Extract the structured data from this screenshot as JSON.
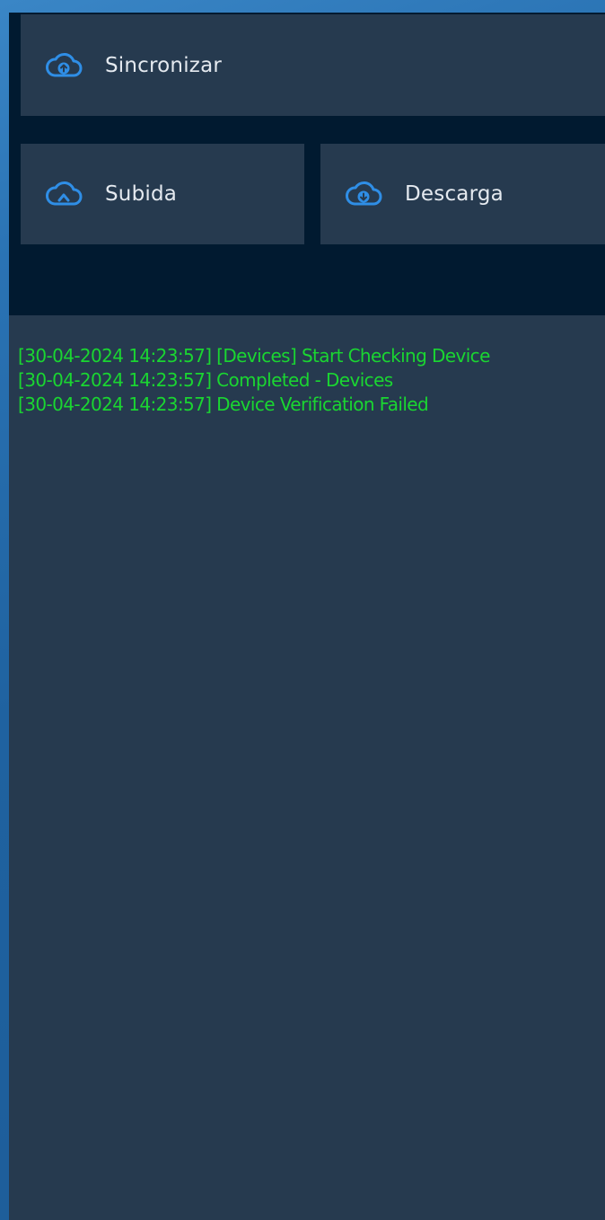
{
  "buttons": {
    "sync": {
      "label": "Sincronizar",
      "icon": "cloud-sync-icon"
    },
    "upload": {
      "label": "Subida",
      "icon": "cloud-upload-icon"
    },
    "download": {
      "label": "Descarga",
      "icon": "cloud-download-icon"
    }
  },
  "log": {
    "lines": [
      "[30-04-2024 14:23:57] [Devices] Start Checking Device",
      "[30-04-2024 14:23:57] Completed - Devices",
      "[30-04-2024 14:23:57] Device Verification Failed"
    ]
  },
  "colors": {
    "accent": "#2f8ee6",
    "log_text": "#1ad631",
    "button_bg": "#263a4f",
    "panel_bg": "#011a30"
  }
}
